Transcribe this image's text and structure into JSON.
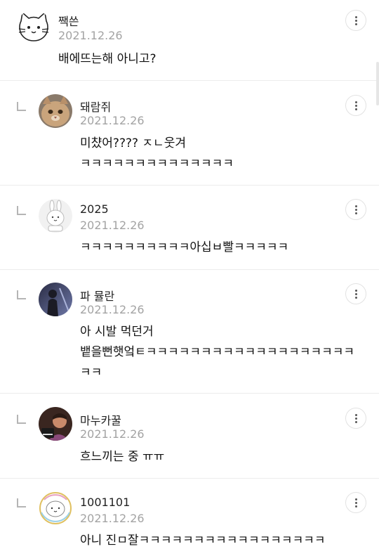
{
  "comments": [
    {
      "name": "짹쓴",
      "date": "2021.12.26",
      "text": "배에뜨는해 아니고?",
      "is_reply": false,
      "avatar": "cat-outline-icon"
    },
    {
      "name": "돼람쥐",
      "date": "2021.12.26",
      "text": "미챴어???? ㅈㄴ웃겨\nㅋㅋㅋㅋㅋㅋㅋㅋㅋㅋㅋㅋㅋㅋ",
      "is_reply": true,
      "avatar": "cat-photo"
    },
    {
      "name": "2025",
      "date": "2021.12.26",
      "text": "ㅋㅋㅋㅋㅋㅋㅋㅋㅋㅋ아십ㅂ빨ㅋㅋㅋㅋㅋ",
      "is_reply": true,
      "avatar": "rabbit-icon"
    },
    {
      "name": "파 뮬란",
      "date": "2021.12.26",
      "text": "아 시발 먹던거\n뱉을뻔햇엌ㅌㅋㅋㅋㅋㅋㅋㅋㅋㅋㅋㅋㅋㅋㅋㅋㅋㅋㅋㅋ\nㅋㅋ",
      "is_reply": true,
      "avatar": "person-photo"
    },
    {
      "name": "마누카꿀",
      "date": "2021.12.26",
      "text": "흐느끼는 중 ㅠㅠ",
      "is_reply": true,
      "avatar": "concert-photo"
    },
    {
      "name": "1001101",
      "date": "2021.12.26",
      "text": "아니 진ㅁ잘ㅋㅋㅋㅋㅋㅋㅋㅋㅋㅋㅋㅋㅋㅋㅋㅋㅋ",
      "is_reply": true,
      "avatar": "rainbow-face-icon"
    }
  ],
  "colors": {
    "date": "#a3a3a3",
    "divider": "#ececec",
    "background": "#ffffff"
  }
}
